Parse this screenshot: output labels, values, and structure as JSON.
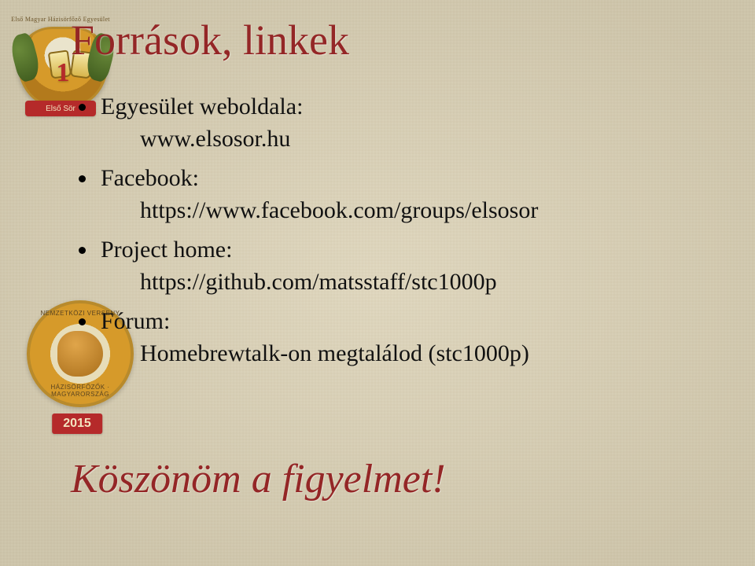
{
  "title": "Források, linkek",
  "bullets": [
    {
      "label": "Egyesület weboldala:",
      "sub": "www.elsosor.hu"
    },
    {
      "label": "Facebook:",
      "sub": "https://www.facebook.com/groups/elsosor"
    },
    {
      "label": "Project home:",
      "sub": "https://github.com/matsstaff/stc1000p"
    },
    {
      "label": "Fórum:",
      "sub": "Homebrewtalk-on megtalálod (stc1000p)"
    }
  ],
  "closing": "Köszönöm a figyelmet!",
  "logo_top": {
    "arc_text": "Első Magyar Házisörfőző Egyesület",
    "number": "1",
    "ribbon": "Első Sör"
  },
  "logo_bottom": {
    "ring_top": "NEMZETKÖZI VERSENY",
    "ring_bottom": "HÁZISÖRFŐZŐK · MAGYARORSZÁG",
    "year": "2015"
  }
}
